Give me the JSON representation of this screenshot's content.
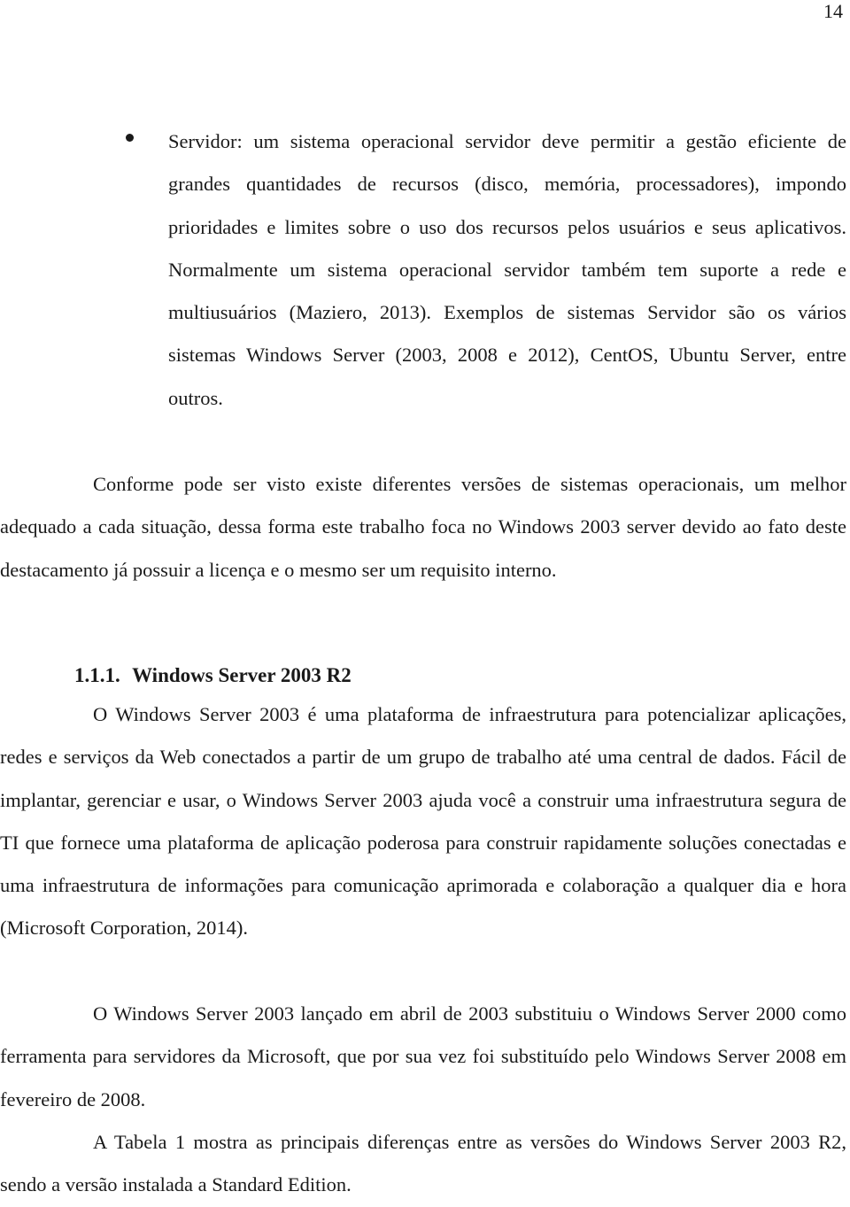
{
  "page_number": "14",
  "bullet": {
    "text": "Servidor: um sistema operacional servidor deve permitir a gestão eficiente de grandes quantidades de recursos (disco, memória, processadores), impondo prioridades e limites sobre o uso dos recursos pelos usuários e seus aplicativos. Normalmente um sistema operacional servidor também tem suporte a rede e multiusuários (Maziero, 2013). Exemplos de sistemas Servidor são os vários sistemas Windows Server (2003, 2008 e 2012), CentOS, Ubuntu Server, entre outros."
  },
  "paragraphs": [
    "Conforme pode ser visto existe diferentes versões de sistemas operacionais, um melhor adequado a cada situação, dessa forma este trabalho foca no Windows 2003 server devido ao fato deste destacamento já possuir a licença e o mesmo ser um requisito interno."
  ],
  "section": {
    "number": "1.1.1.",
    "title": "Windows Server 2003 R2"
  },
  "section_paragraphs": [
    "O Windows Server 2003 é uma plataforma de infraestrutura para potencializar aplicações, redes e serviços da Web conectados a partir de um grupo de trabalho até uma central de dados. Fácil de implantar, gerenciar e usar, o Windows Server 2003 ajuda você a construir uma infraestrutura segura de TI que fornece uma plataforma de aplicação poderosa para construir rapidamente soluções conectadas e uma infraestrutura de informações para comunicação aprimorada e colaboração a qualquer dia e hora (Microsoft Corporation, 2014).",
    "O Windows Server 2003 lançado em abril de 2003 substituiu o Windows Server 2000 como ferramenta para servidores da Microsoft, que por sua vez foi substituído pelo Windows Server 2008 em fevereiro de 2008.",
    "A Tabela 1 mostra as principais diferenças entre as versões do Windows Server 2003 R2, sendo a versão instalada a Standard Edition."
  ]
}
